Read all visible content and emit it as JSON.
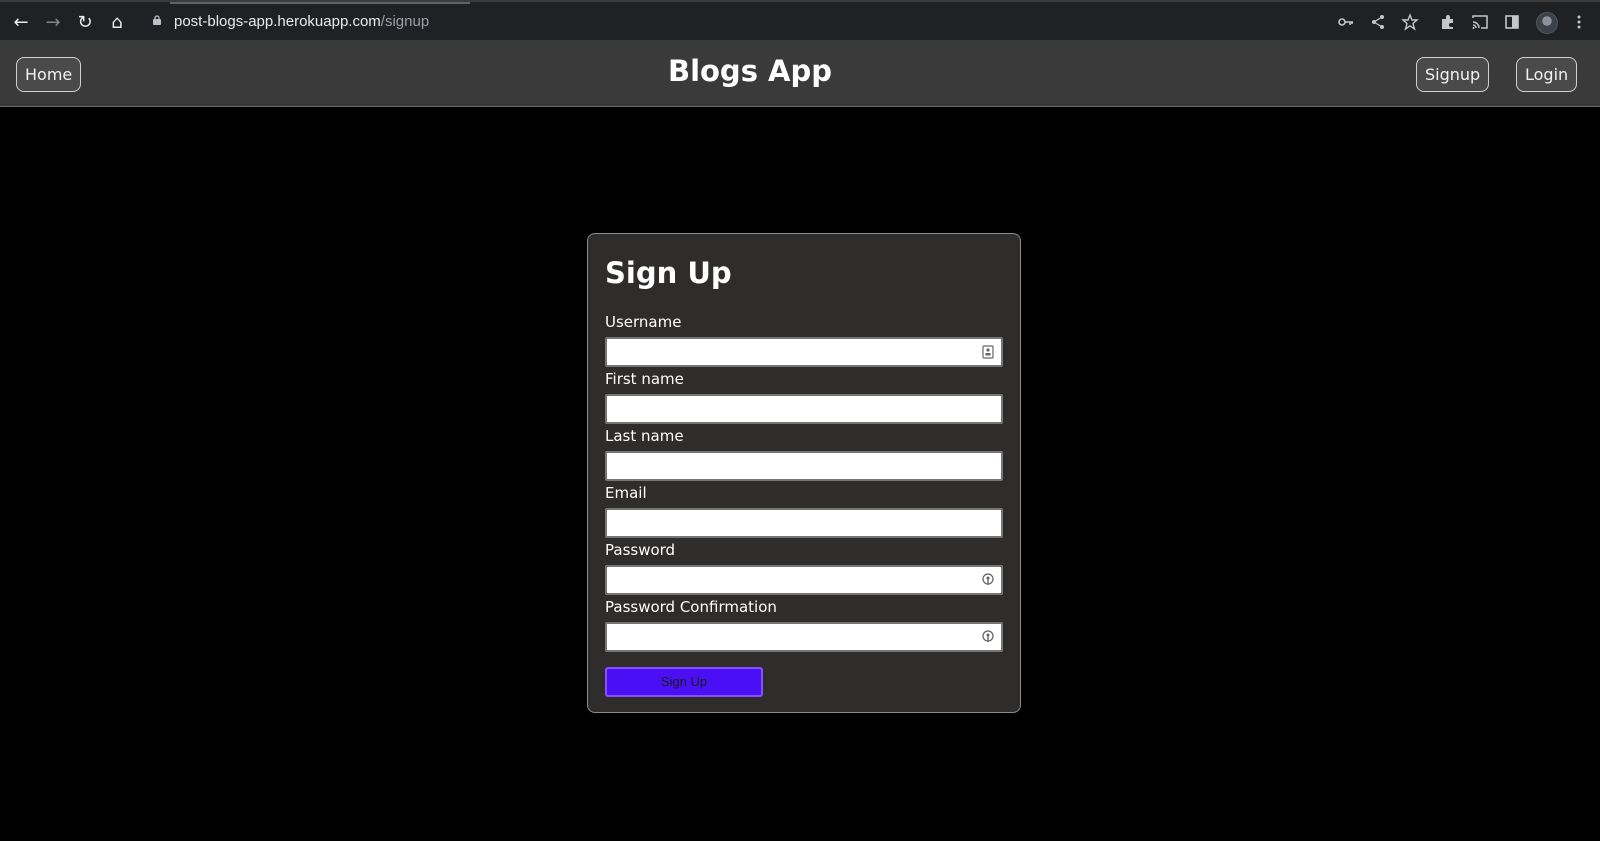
{
  "browser": {
    "url_host": "post-blogs-app.herokuapp.com",
    "url_path": "/signup"
  },
  "header": {
    "home_label": "Home",
    "title": "Blogs App",
    "signup_label": "Signup",
    "login_label": "Login"
  },
  "form": {
    "title": "Sign Up",
    "fields": [
      {
        "label": "Username",
        "value": "",
        "icon": "contact-card-icon"
      },
      {
        "label": "First name",
        "value": ""
      },
      {
        "label": "Last name",
        "value": ""
      },
      {
        "label": "Email",
        "value": ""
      },
      {
        "label": "Password",
        "value": "",
        "icon": "password-key-icon"
      },
      {
        "label": "Password Confirmation",
        "value": "",
        "icon": "password-key-icon"
      }
    ],
    "submit_label": "Sign Up"
  },
  "colors": {
    "page_bg": "#000000",
    "header_bg": "#3a3a3a",
    "card_bg": "#2f2d2c",
    "submit_bg": "#4b0ff5"
  }
}
